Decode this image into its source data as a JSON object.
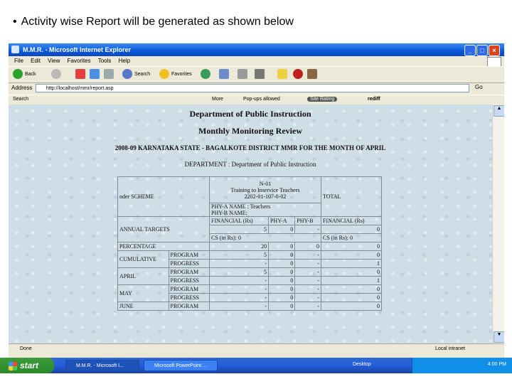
{
  "caption": {
    "bullet": "•",
    "text": "Activity wise Report will be generated as shown below"
  },
  "window": {
    "title": "M.M.R. - Microsoft Internet Explorer",
    "minimize": "_",
    "maximize": "□",
    "close": "×",
    "menu": [
      "File",
      "Edit",
      "View",
      "Favorites",
      "Tools",
      "Help"
    ],
    "toolbar": {
      "back": "Back",
      "search": "Search",
      "favorites": "Favorites"
    },
    "address_label": "Address",
    "address_value": "http://localhost/mmr/report.asp",
    "go": "Go",
    "gbar": {
      "search": "Search",
      "more": "More",
      "popups": "Pop-ups allowed",
      "rating": "Site Rating",
      "rediff": "rediff"
    },
    "status": {
      "left": "Done",
      "right": "Local intranet"
    }
  },
  "report": {
    "heading1": "Department of Public Instruction",
    "heading2": "Monthly Monitoring Review",
    "heading3": "2008-09 KARNATAKA STATE - BAGALKOTE DISTRICT MMR FOR THE MONTH OF APRIL",
    "heading4": "DEPARTMENT : Department of Public Instruction",
    "scheme_label": "nder SCHEME",
    "activity_code": "N-01",
    "activity_name": "Training to Inservice Teachers",
    "activity_code2": "2202-01-107-0-02",
    "total_label": "TOTAL",
    "pyt_label": "PHY-A NAME : Teachers",
    "pyt_label2": "PHY-B NAME:",
    "col_fin": "FINANCIAL (Rs)",
    "col_phy_a": "PHY-A",
    "col_phy_b": "PHY-B",
    "col_fin_total": "FINANCIAL (Rs)",
    "annual_targets": "ANNUAL TARGETS",
    "annual_vals": [
      "5",
      "0",
      "-",
      "0"
    ],
    "cs_left": "CS (in Rs): 0",
    "cs_right": "CS (in Rs): 0",
    "rows": [
      {
        "label": "PERCENTAGE",
        "sub": "",
        "vals": [
          "20",
          "0",
          "0",
          "0"
        ]
      },
      {
        "label": "CUMULATIVE",
        "sub": "PROGRAM",
        "vals": [
          "5",
          "0",
          "-",
          "0"
        ]
      },
      {
        "label": "",
        "sub": "PROGRESS",
        "vals": [
          "-",
          "0",
          "-",
          "1"
        ]
      },
      {
        "label": "APRIL",
        "sub": "PROGRAM",
        "vals": [
          "5",
          "0",
          "-",
          "0"
        ]
      },
      {
        "label": "",
        "sub": "PROGRESS",
        "vals": [
          "-",
          "0",
          "-",
          "1"
        ]
      },
      {
        "label": "MAY",
        "sub": "PROGRAM",
        "vals": [
          "-",
          "0",
          "-",
          "0"
        ]
      },
      {
        "label": "",
        "sub": "PROGRESS",
        "vals": [
          "-",
          "0",
          "-",
          "0"
        ]
      },
      {
        "label": "JUNE",
        "sub": "PROGRAM",
        "vals": [
          "-",
          "0",
          "-",
          "0"
        ]
      }
    ]
  },
  "taskbar": {
    "start": "start",
    "tasks": [
      "M.M.R. - Microsoft I...",
      "Microsoft PowerPoint ..."
    ],
    "tray_text": "Desktop",
    "clock": "4:00 PM"
  }
}
